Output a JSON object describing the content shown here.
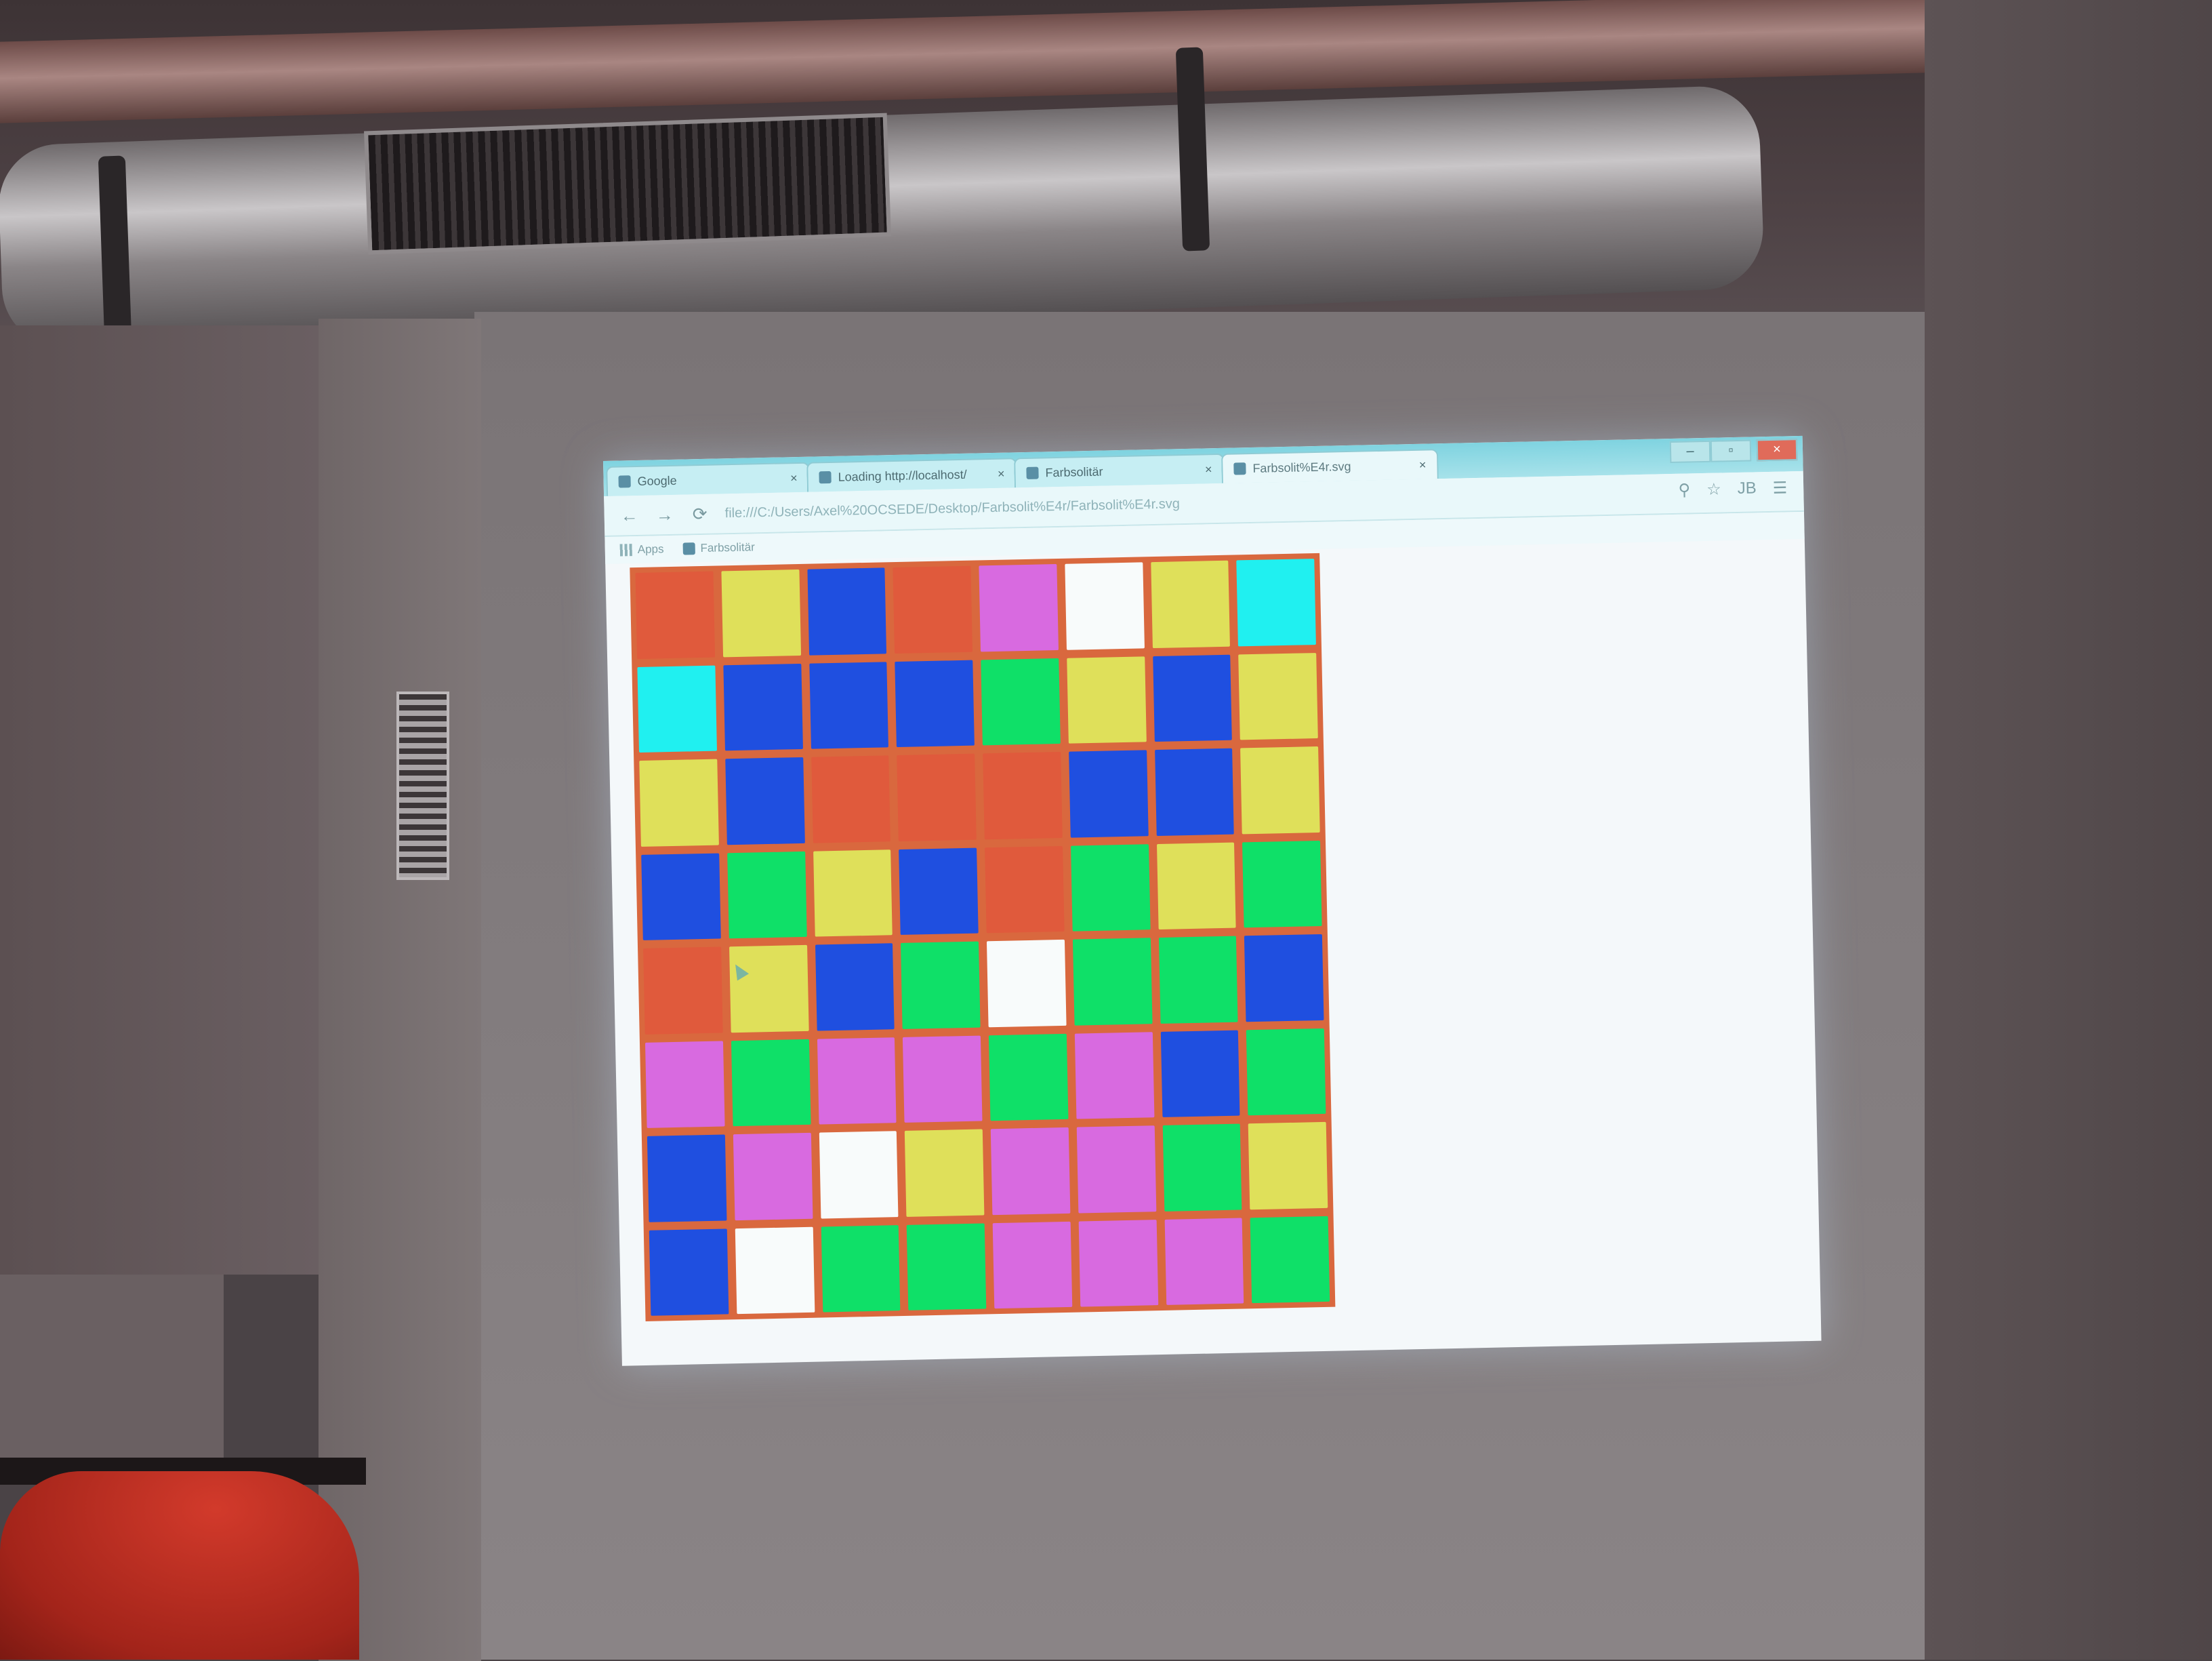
{
  "browser": {
    "tabs": [
      {
        "label": "Google",
        "close": "×"
      },
      {
        "label": "Loading http://localhost/",
        "close": "×"
      },
      {
        "label": "Farbsolitär",
        "close": "×"
      },
      {
        "label": "Farbsolit%E4r.svg",
        "close": "×"
      }
    ],
    "window_controls": [
      "–",
      "▫",
      "×"
    ],
    "address": "file:///C:/Users/Axel%20OCSEDE/Desktop/Farbsolit%E4r/Farbsolit%E4r.svg",
    "profile_initials": "JB",
    "bookmarks": [
      {
        "label": "Apps"
      },
      {
        "label": "Farbsolitär"
      }
    ]
  },
  "game": {
    "colors": {
      "red": "#e05a3c",
      "yellow": "#dfe05a",
      "blue": "#1f4fe0",
      "magenta": "#d86ae0",
      "white": "#f8fbfb",
      "cyan": "#20f0f0",
      "green": "#0fe068",
      "board_border": "#d9683e"
    },
    "grid": [
      [
        "red",
        "yellow",
        "blue",
        "red",
        "magenta",
        "white",
        "yellow",
        "cyan"
      ],
      [
        "cyan",
        "blue",
        "blue",
        "blue",
        "green",
        "yellow",
        "blue",
        "yellow"
      ],
      [
        "yellow",
        "blue",
        "red",
        "red",
        "red",
        "blue",
        "blue",
        "yellow"
      ],
      [
        "blue",
        "green",
        "yellow",
        "blue",
        "red",
        "green",
        "yellow",
        "green"
      ],
      [
        "red",
        "yellow",
        "blue",
        "green",
        "white",
        "green",
        "green",
        "blue"
      ],
      [
        "magenta",
        "green",
        "magenta",
        "magenta",
        "green",
        "magenta",
        "blue",
        "green"
      ],
      [
        "blue",
        "magenta",
        "white",
        "yellow",
        "magenta",
        "magenta",
        "green",
        "yellow"
      ],
      [
        "blue",
        "white",
        "green",
        "green",
        "magenta",
        "magenta",
        "magenta",
        "green"
      ]
    ]
  }
}
